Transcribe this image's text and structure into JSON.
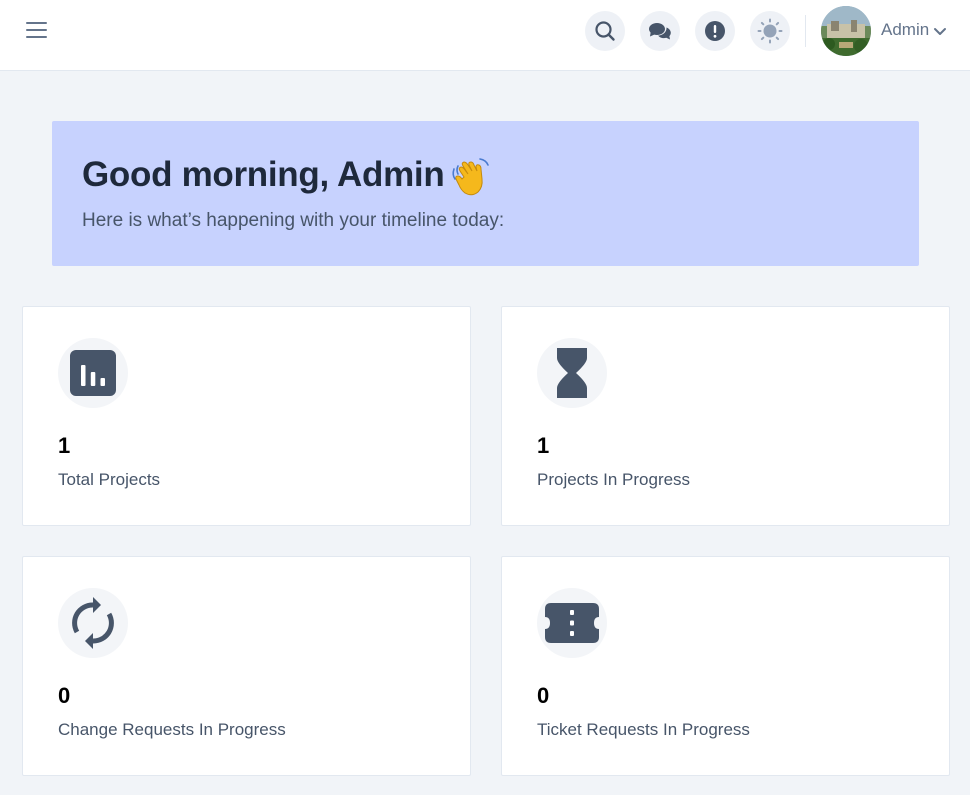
{
  "header": {
    "user_name": "Admin",
    "icons": [
      "menu-icon",
      "search-icon",
      "chat-icon",
      "alert-icon",
      "theme-toggle-icon",
      "chevron-down-icon"
    ]
  },
  "welcome": {
    "title": "Good morning, Admin",
    "emoji": "👋",
    "subtitle": "Here is what’s happening with your timeline today:",
    "background": "#c7d2fe"
  },
  "stats": [
    {
      "value": "1",
      "label": "Total Projects",
      "icon": "bar-chart-icon"
    },
    {
      "value": "1",
      "label": "Projects In Progress",
      "icon": "hourglass-icon"
    },
    {
      "value": "0",
      "label": "Change Requests In Progress",
      "icon": "refresh-icon"
    },
    {
      "value": "0",
      "label": "Ticket Requests In Progress",
      "icon": "ticket-icon"
    }
  ],
  "colors": {
    "page_background": "#f1f4f8",
    "icon_color": "#475569",
    "card_background": "#ffffff"
  }
}
